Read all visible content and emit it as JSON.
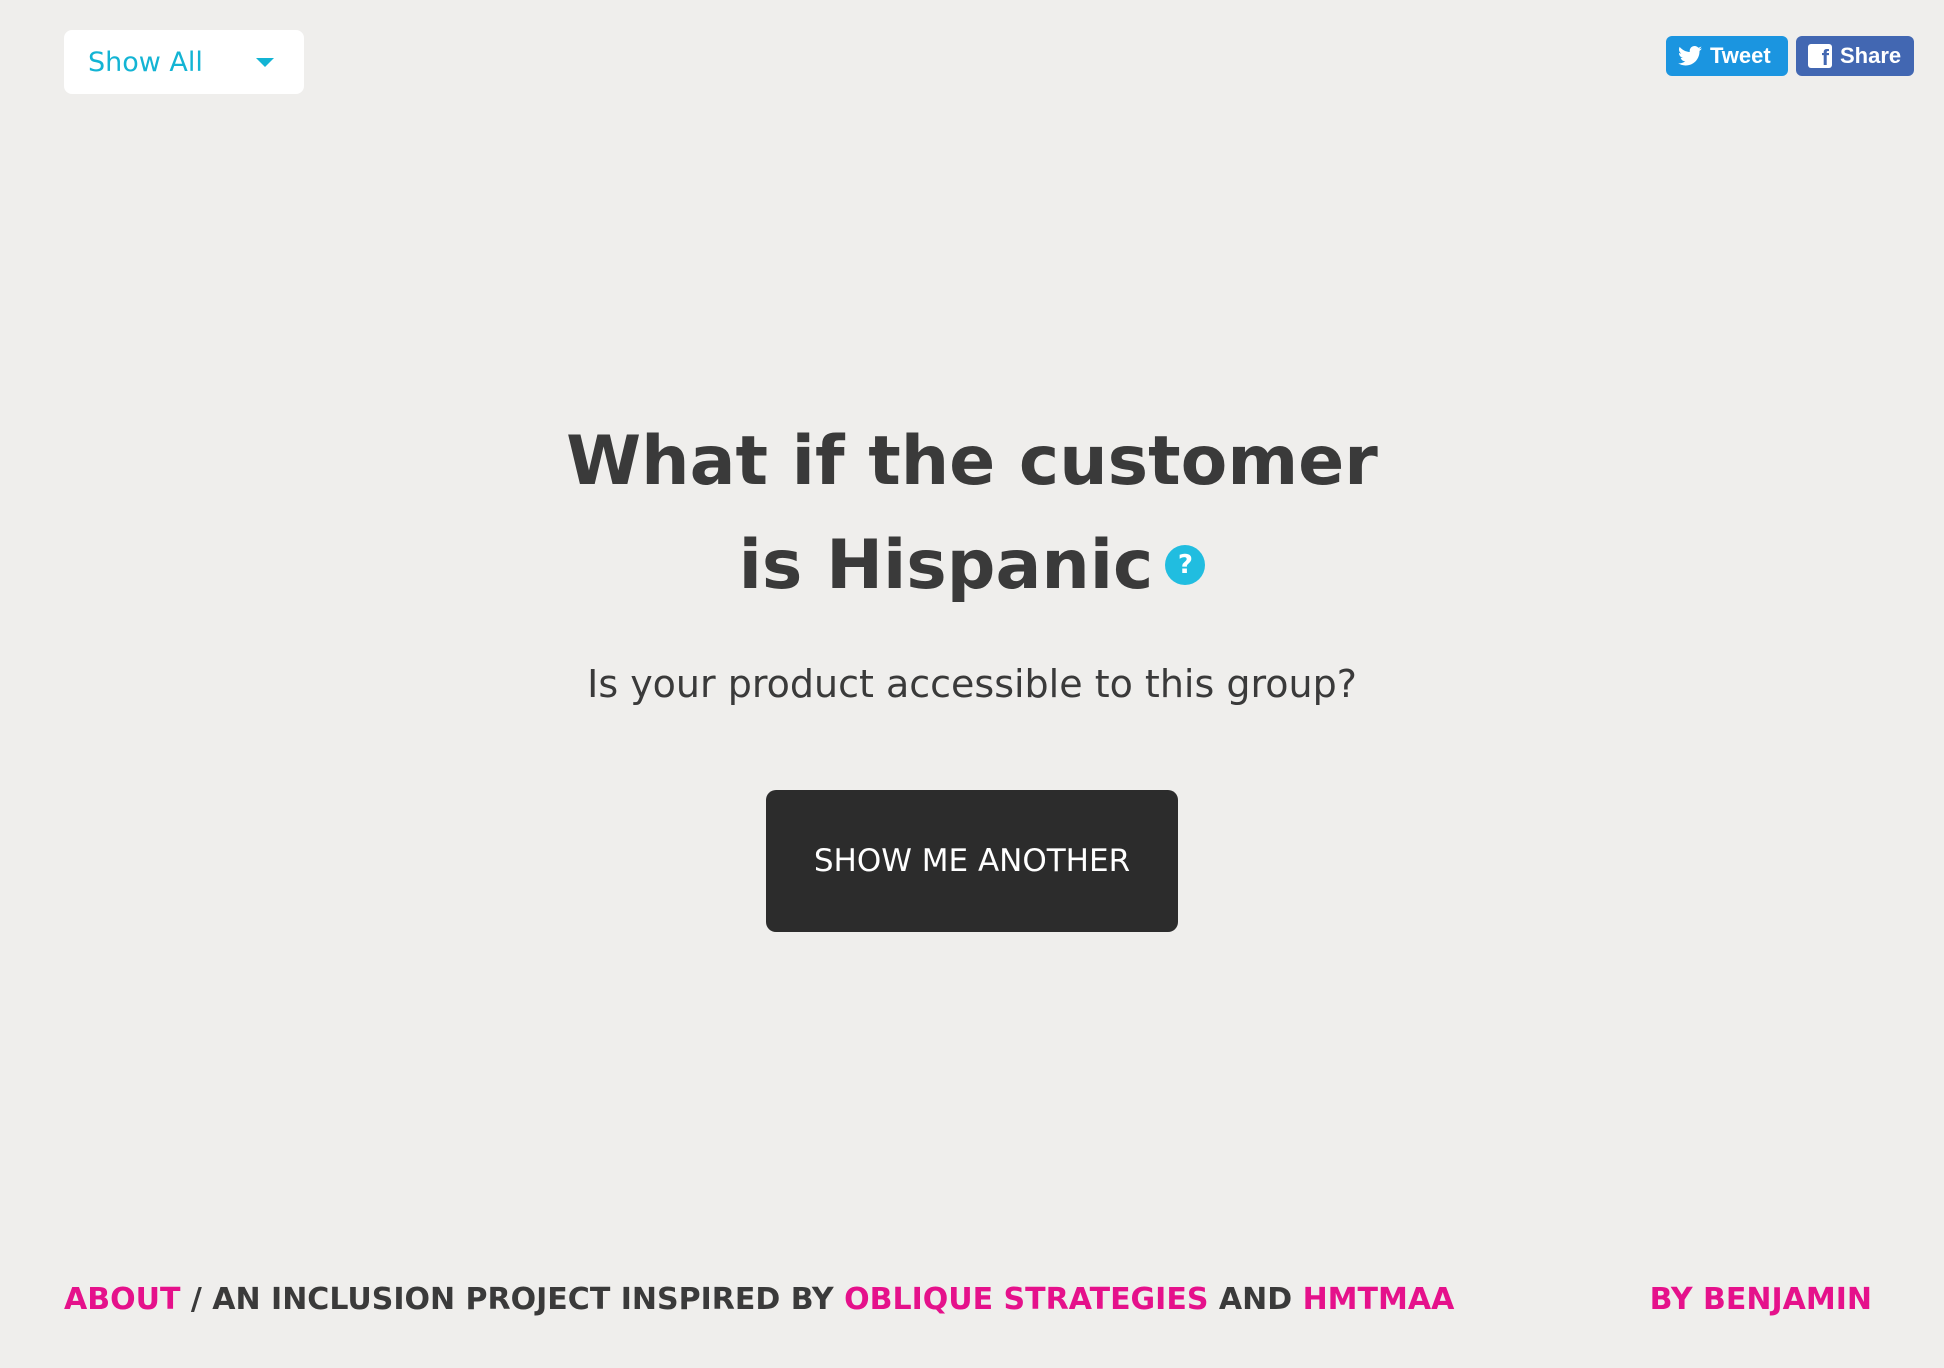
{
  "filter": {
    "selected": "Show All"
  },
  "social": {
    "tweet_label": "Tweet",
    "share_label": "Share"
  },
  "main": {
    "headline": "What if the customer is Hispanic",
    "help_icon_glyph": "?",
    "subtext": "Is your product accessible to this group?",
    "button_label": "SHOW ME ANOTHER"
  },
  "footer": {
    "about_link": "ABOUT",
    "mid_text_1": " / AN INCLUSION PROJECT INSPIRED BY ",
    "oblique_link": "OBLIQUE STRATEGIES",
    "mid_text_2": " AND ",
    "hmtmaa_link": "HMTMAA",
    "author_link": "BY BENJAMIN"
  },
  "colors": {
    "background": "#efeeec",
    "accent_cyan": "#13b4d4",
    "link_pink": "#e5118b",
    "button_dark": "#2c2c2c",
    "twitter_blue": "#1b95e0",
    "facebook_blue": "#4267b2"
  },
  "icons": {
    "dropdown": "chevron-down-icon",
    "twitter": "twitter-bird-icon",
    "facebook": "facebook-icon",
    "help": "help-circle-icon"
  }
}
